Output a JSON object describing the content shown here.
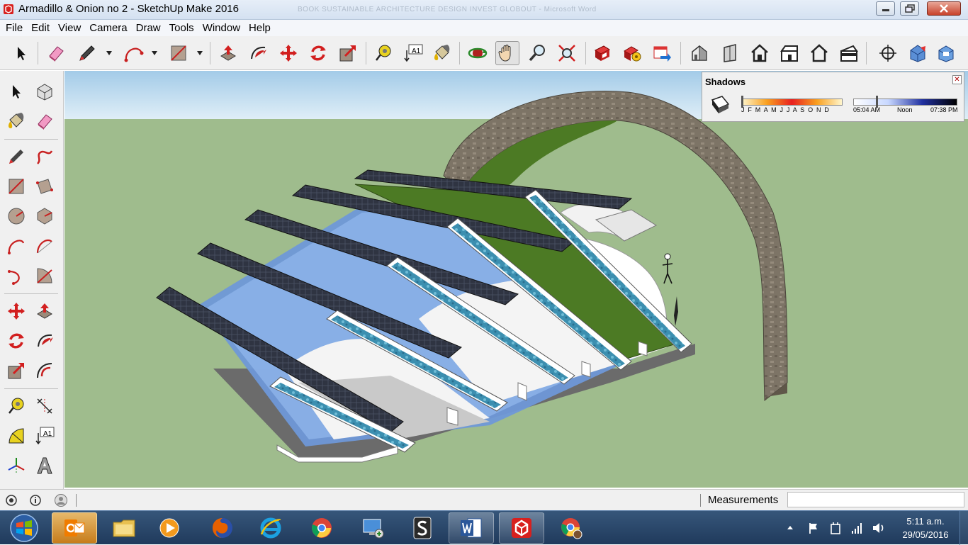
{
  "window": {
    "title": "Armadillo & Onion no 2 - SketchUp Make 2016",
    "background_title": "BOOK SUSTAINABLE ARCHITECTURE DESIGN INVEST GLOBOUT - Microsoft Word"
  },
  "menu": [
    "File",
    "Edit",
    "View",
    "Camera",
    "Draw",
    "Tools",
    "Window",
    "Help"
  ],
  "toolbar": {
    "icons": [
      "select-icon",
      "eraser-icon",
      "pencil-icon",
      "arc-icon",
      "rectangle-icon",
      "push-pull-icon",
      "follow-me-icon",
      "move-icon",
      "rotate-icon",
      "scale-icon",
      "tape-measure-icon",
      "text-icon",
      "paint-bucket-icon",
      "orbit-icon",
      "pan-icon",
      "zoom-icon",
      "zoom-extents-icon",
      "3d-warehouse-icon",
      "extension-warehouse-icon",
      "share-model-icon",
      "iso-view-icon",
      "top-view-icon",
      "front-view-icon",
      "right-view-icon",
      "back-view-icon",
      "left-view-icon",
      "position-camera-icon",
      "section-plane-icon",
      "display-section-icon"
    ],
    "text_tool_label": "A1",
    "active": "pan-icon"
  },
  "left_toolbar": {
    "text_tool_label": "A1"
  },
  "shadows_panel": {
    "title": "Shadows",
    "months": "J F M A M J J A S O N D",
    "time_start": "05:04 AM",
    "time_mid": "Noon",
    "time_end": "07:38 PM"
  },
  "status": {
    "measurements_label": "Measurements",
    "measurements_value": ""
  },
  "taskbar": {
    "apps": [
      "outlook-icon",
      "file-explorer-icon",
      "media-player-icon",
      "firefox-icon",
      "internet-explorer-icon",
      "chrome-icon",
      "remote-desktop-icon",
      "scrivener-icon",
      "word-icon",
      "sketchup-icon",
      "chrome-profile-icon"
    ],
    "time": "5:11 a.m.",
    "date": "29/05/2016"
  },
  "colors": {
    "ground": "#9fbc8d",
    "sky": "#a3cbe8",
    "solar_panel": "#2f3442",
    "glass": "#6f98d8",
    "green_roof": "#4c7a24",
    "stone_arch": "#7d7466"
  }
}
